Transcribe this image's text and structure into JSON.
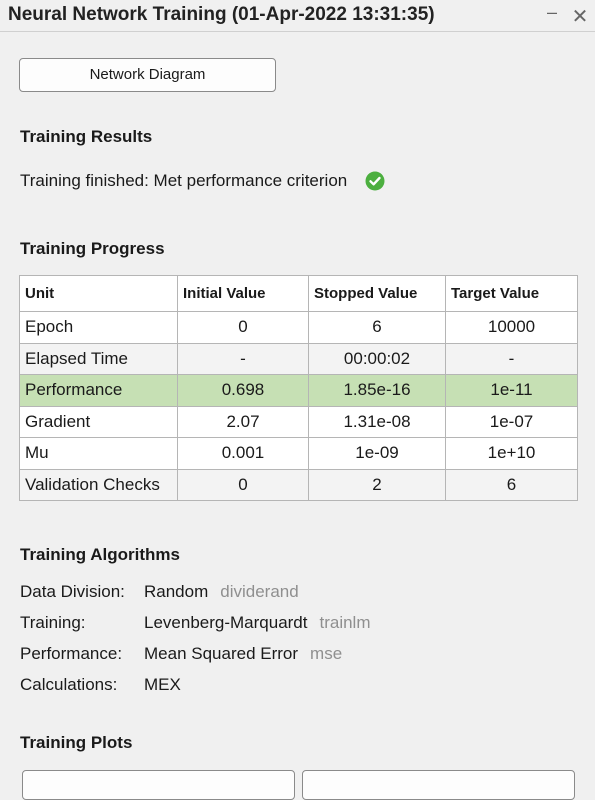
{
  "window": {
    "title": "Neural Network Training (01-Apr-2022 13:31:35)",
    "minimize_glyph": "–",
    "close_glyph": "✕"
  },
  "diagram_button": {
    "label": "Network Diagram"
  },
  "results": {
    "heading": "Training Results",
    "status": "Training finished: Met performance criterion",
    "status_icon": "check-circle-icon",
    "status_color": "#4caf3f"
  },
  "progress": {
    "heading": "Training Progress",
    "columns": [
      "Unit",
      "Initial Value",
      "Stopped Value",
      "Target Value"
    ],
    "rows": [
      [
        "Epoch",
        "0",
        "6",
        "10000"
      ],
      [
        "Elapsed Time",
        "-",
        "00:00:02",
        "-"
      ],
      [
        "Performance",
        "0.698",
        "1.85e-16",
        "1e-11"
      ],
      [
        "Gradient",
        "2.07",
        "1.31e-08",
        "1e-07"
      ],
      [
        "Mu",
        "0.001",
        "1e-09",
        "1e+10"
      ],
      [
        "Validation Checks",
        "0",
        "2",
        "6"
      ]
    ],
    "highlight_color": "#c6e0b4"
  },
  "algorithms": {
    "heading": "Training Algorithms",
    "items": [
      {
        "label": "Data Division:",
        "value": "Random",
        "fn": "dividerand"
      },
      {
        "label": "Training:",
        "value": "Levenberg-Marquardt",
        "fn": "trainlm"
      },
      {
        "label": "Performance:",
        "value": "Mean Squared Error",
        "fn": "mse"
      },
      {
        "label": "Calculations:",
        "value": "MEX",
        "fn": ""
      }
    ]
  },
  "plots": {
    "heading": "Training Plots"
  }
}
